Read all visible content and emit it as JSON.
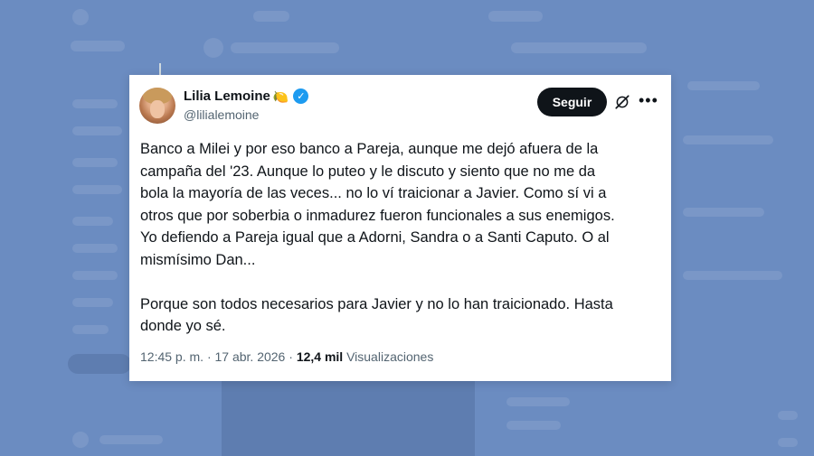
{
  "author": {
    "name": "Lilia Lemoine",
    "emoji": "🍋",
    "handle": "@lilialemoine"
  },
  "actions": {
    "follow_label": "Seguir"
  },
  "tweet": {
    "text": "Banco a Milei y por eso banco a Pareja, aunque me dejó afuera de la\ncampaña del '23. Aunque lo puteo y le discuto y siento que no me da\nbola la mayoría de las veces... no lo ví traicionar a Javier. Como sí vi a\notros que por soberbia o inmadurez fueron funcionales a sus enemigos.\nYo defiendo a Pareja igual que a Adorni, Sandra o a Santi Caputo. O al\nmismísimo Dan...\n\nPorque son todos necesarios para Javier y no lo han traicionado. Hasta\ndonde yo sé."
  },
  "meta": {
    "time": "12:45 p. m.",
    "separator": "·",
    "date": "17 abr. 2026",
    "views_count": "12,4 mil",
    "views_label": "Visualizaciones"
  },
  "colors": {
    "background": "#6b8cc1",
    "verified": "#1d9bf0",
    "follow_button": "#0f1419",
    "secondary_text": "#536471"
  }
}
